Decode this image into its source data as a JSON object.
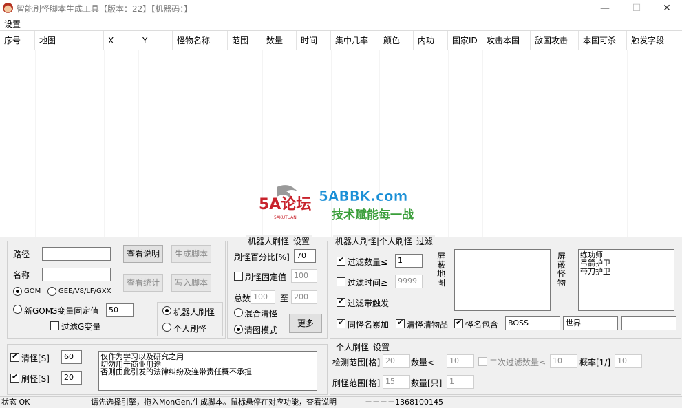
{
  "window": {
    "title": "智能刷怪脚本生成工具【版本：22】【机器码：】",
    "minimize": "—",
    "maximize": "☐",
    "close": "✕"
  },
  "menu": {
    "settings": "设置"
  },
  "table": {
    "columns": [
      "序号",
      "地图",
      "X",
      "Y",
      "怪物名称",
      "范围",
      "数量",
      "时间",
      "集中几率",
      "颜色",
      "内功",
      "国家ID",
      "攻击本国",
      "敌国攻击",
      "本国可杀",
      "触发字段"
    ]
  },
  "left_panel": {
    "path_label": "路径",
    "path_value": "",
    "name_label": "名称",
    "name_value": "",
    "btn_view_help": "查看说明",
    "btn_generate": "生成脚本",
    "btn_view_stats": "查看统计",
    "btn_write": "写入脚本",
    "radio_gom": "GOM",
    "radio_gee": "GEE/V8/LF/GXX",
    "radio_newgom": "新GOM",
    "g_var_label": "G变量固定值",
    "g_var_value": "50",
    "chk_filter_g": "过滤G变量",
    "radio_robot": "机器人刷怪",
    "radio_personal": "个人刷怪"
  },
  "robot_settings": {
    "title": "机器人刷怪_设置",
    "percent_label": "刷怪百分比[%]",
    "percent_value": "70",
    "fixed_label": "刷怪固定值",
    "fixed_value": "100",
    "total_label": "总数",
    "total_min": "100",
    "to_label": "至",
    "total_max": "200",
    "mixed_clear": "混合清怪",
    "clear_map_mode": "清图模式",
    "more_btn": "更多"
  },
  "filter": {
    "title": "机器人刷怪|个人刷怪_过滤",
    "filter_count_label": "过滤数量≤",
    "filter_count_value": "1",
    "filter_time_label": "过滤时间≥",
    "filter_time_value": "9999",
    "filter_trigger_label": "过滤带触发",
    "shield_map_label": "屏蔽地图",
    "shield_monster_label": "屏蔽怪物",
    "shield_monsters": [
      "练功师",
      "弓箭护卫",
      "带刀护卫"
    ],
    "same_name_accum": "同怪名累加",
    "clear_items": "清怪清物品",
    "name_contains": "怪名包含",
    "contains_1": "BOSS",
    "contains_2": "世界",
    "contains_3": ""
  },
  "bottom_left": {
    "clear_label": "清怪[S]",
    "clear_value": "60",
    "spawn_label": "刷怪[S]",
    "spawn_value": "20",
    "log_lines": [
      "仅作为学习以及研究之用",
      "切勿用于商业用途",
      "否则由此引发的法律纠纷及连带责任概不承担"
    ]
  },
  "personal_settings": {
    "title": "个人刷怪_设置",
    "detect_label": "检测范围[格]",
    "detect_value": "20",
    "count_lt_label": "数量<",
    "count_lt_value": "10",
    "second_filter_label": "二次过滤数量≤",
    "second_filter_value": "10",
    "prob_label": "概率[1/]",
    "prob_value": "10",
    "spawn_range_label": "刷怪范围[格]",
    "spawn_range_value": "15",
    "count_only_label": "数量[只]",
    "count_only_value": "1"
  },
  "status": {
    "state": "状态 OK",
    "hint": "请先选择引擎，拖入MonGen,生成脚本。鼠标悬停在对应功能，查看说明",
    "contact": "－－－－1368100145"
  },
  "watermark": {
    "logo": "5A论坛",
    "logo_sub": "5AKUTUAN",
    "site": "5ABBK.com",
    "slogan": "技术赋能每一战"
  },
  "colors": {
    "watermark_red": "#c8232c",
    "watermark_blue": "#1a8fd6",
    "watermark_green": "#3a9e3a"
  }
}
